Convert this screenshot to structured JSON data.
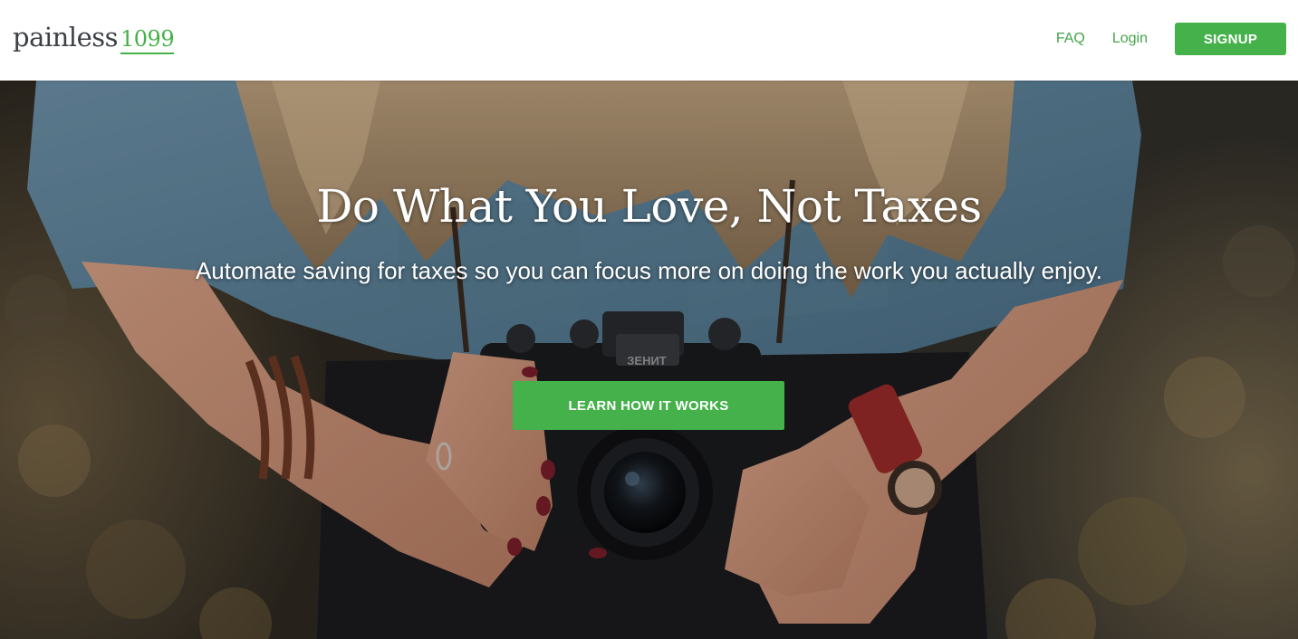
{
  "header": {
    "logo": {
      "word": "painless",
      "number": "1099"
    },
    "nav": {
      "faq_label": "FAQ",
      "login_label": "Login",
      "signup_label": "SIGNUP"
    }
  },
  "hero": {
    "title": "Do What You Love, Not Taxes",
    "subtitle": "Automate saving for taxes so you can focus more on doing the work you actually enjoy.",
    "cta_label": "LEARN HOW IT WORKS",
    "camera_brand": "ЗЕНИТ"
  },
  "colors": {
    "brand_green": "#44b14a",
    "logo_text": "#3d4047",
    "nav_link": "#44a54a"
  }
}
